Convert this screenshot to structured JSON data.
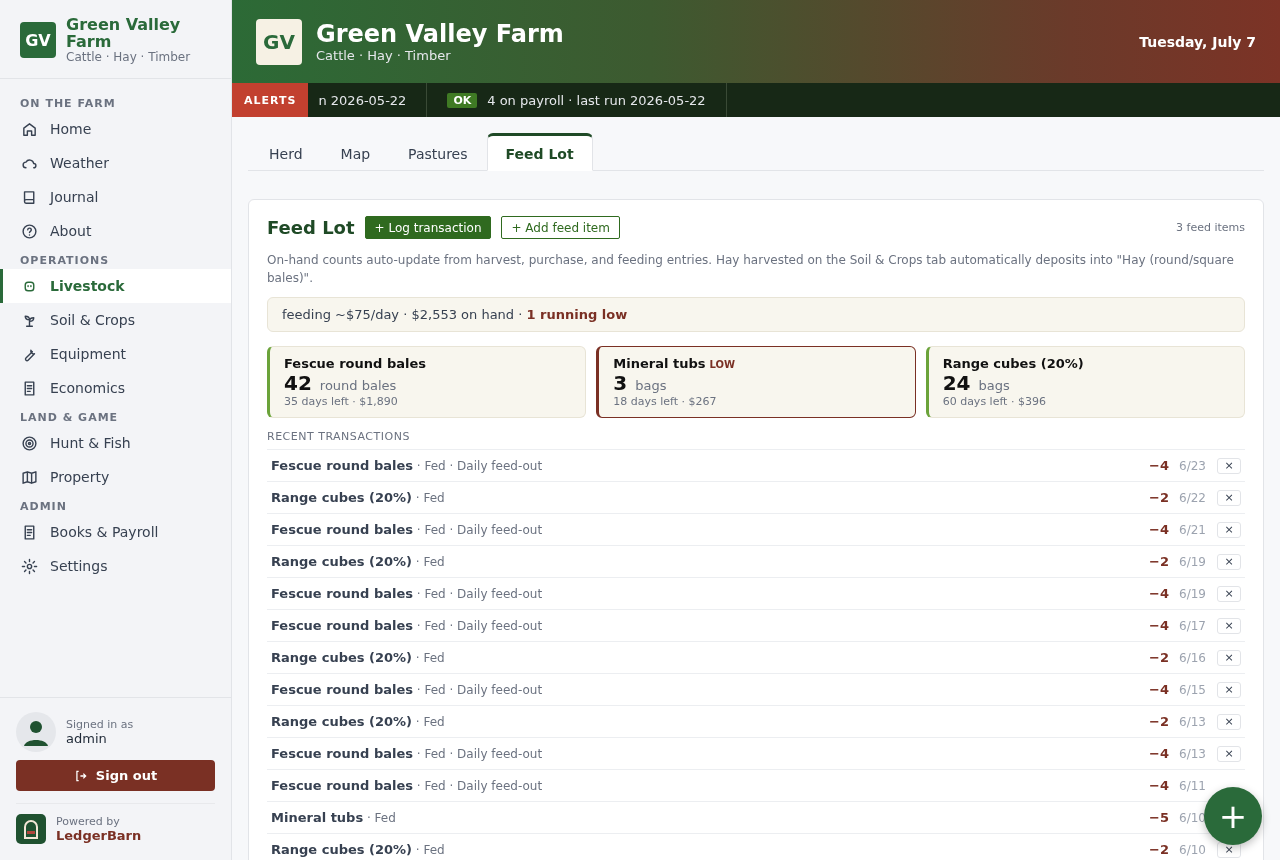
{
  "sidebar": {
    "logo": "GV",
    "farm_name": "Green Valley Farm",
    "tagline": "Cattle · Hay · Timber",
    "sections": [
      {
        "title": "ON THE FARM",
        "items": [
          {
            "label": "Home",
            "selected": false
          },
          {
            "label": "Weather",
            "selected": false
          },
          {
            "label": "Journal",
            "selected": false
          },
          {
            "label": "About",
            "selected": false
          }
        ]
      },
      {
        "title": "OPERATIONS",
        "items": [
          {
            "label": "Livestock",
            "selected": true
          },
          {
            "label": "Soil & Crops",
            "selected": false
          },
          {
            "label": "Equipment",
            "selected": false
          },
          {
            "label": "Economics",
            "selected": false
          }
        ]
      },
      {
        "title": "LAND & GAME",
        "items": [
          {
            "label": "Hunt & Fish",
            "selected": false
          },
          {
            "label": "Property",
            "selected": false
          }
        ]
      },
      {
        "title": "ADMIN",
        "items": [
          {
            "label": "Books & Payroll",
            "selected": false
          },
          {
            "label": "Settings",
            "selected": false
          }
        ]
      }
    ],
    "user": {
      "caption": "Signed in as",
      "name": "admin"
    },
    "sign_out": "Sign out",
    "powered": {
      "caption": "Powered by",
      "brand": "LedgerBarn"
    }
  },
  "header": {
    "logo": "GV",
    "title": "Green Valley Farm",
    "subtitle": "Cattle · Hay · Timber",
    "date": "Tuesday, July 7"
  },
  "alerts": {
    "label": "ALERTS",
    "items": [
      {
        "text": "n 2026-05-22"
      },
      {
        "badge": "OK",
        "text": "4 on payroll · last run 2026-05-22"
      }
    ]
  },
  "tabs": [
    {
      "label": "Herd",
      "selected": false
    },
    {
      "label": "Map",
      "selected": false
    },
    {
      "label": "Pastures",
      "selected": false
    },
    {
      "label": "Feed Lot",
      "selected": true
    }
  ],
  "feed_lot": {
    "title": "Feed Lot",
    "log_button": "+ Log transaction",
    "add_button": "+ Add feed item",
    "count": "3 feed items",
    "description": "On-hand counts auto-update from harvest, purchase, and feeding entries. Hay harvested on the Soil & Crops tab automatically deposits into \"Hay (round/square bales)\".",
    "summary": "feeding ~$75/day · $2,553 on hand · **1 running low**",
    "items": [
      {
        "name": "Fescue round bales",
        "low": false,
        "qty": "42",
        "unit": "round bales",
        "detail": "35 days left · $1,890"
      },
      {
        "name": "Mineral tubs",
        "low": true,
        "low_label": "LOW",
        "qty": "3",
        "unit": "bags",
        "detail": "18 days left · $267"
      },
      {
        "name": "Range cubes (20%)",
        "low": false,
        "qty": "24",
        "unit": "bags",
        "detail": "60 days left · $396"
      }
    ],
    "recent_title": "RECENT TRANSACTIONS",
    "transactions": [
      {
        "item": "Fescue round bales",
        "note": " · Fed · Daily feed-out",
        "qty": "−4",
        "date": "6/23",
        "delete": "×"
      },
      {
        "item": "Range cubes (20%)",
        "note": " · Fed",
        "qty": "−2",
        "date": "6/22",
        "delete": "×"
      },
      {
        "item": "Fescue round bales",
        "note": " · Fed · Daily feed-out",
        "qty": "−4",
        "date": "6/21",
        "delete": "×"
      },
      {
        "item": "Range cubes (20%)",
        "note": " · Fed",
        "qty": "−2",
        "date": "6/19",
        "delete": "×"
      },
      {
        "item": "Fescue round bales",
        "note": " · Fed · Daily feed-out",
        "qty": "−4",
        "date": "6/19",
        "delete": "×"
      },
      {
        "item": "Fescue round bales",
        "note": " · Fed · Daily feed-out",
        "qty": "−4",
        "date": "6/17",
        "delete": "×"
      },
      {
        "item": "Range cubes (20%)",
        "note": " · Fed",
        "qty": "−2",
        "date": "6/16",
        "delete": "×"
      },
      {
        "item": "Fescue round bales",
        "note": " · Fed · Daily feed-out",
        "qty": "−4",
        "date": "6/15",
        "delete": "×"
      },
      {
        "item": "Range cubes (20%)",
        "note": " · Fed",
        "qty": "−2",
        "date": "6/13",
        "delete": "×"
      },
      {
        "item": "Fescue round bales",
        "note": " · Fed · Daily feed-out",
        "qty": "−4",
        "date": "6/13",
        "delete": "×"
      },
      {
        "item": "Fescue round bales",
        "note": " · Fed · Daily feed-out",
        "qty": "−4",
        "date": "6/11"
      },
      {
        "item": "Mineral tubs",
        "note": " · Fed",
        "qty": "−5",
        "date": "6/10"
      },
      {
        "item": "Range cubes (20%)",
        "note": " · Fed",
        "qty": "−2",
        "date": "6/10",
        "delete": "×"
      }
    ]
  },
  "fab": "+"
}
